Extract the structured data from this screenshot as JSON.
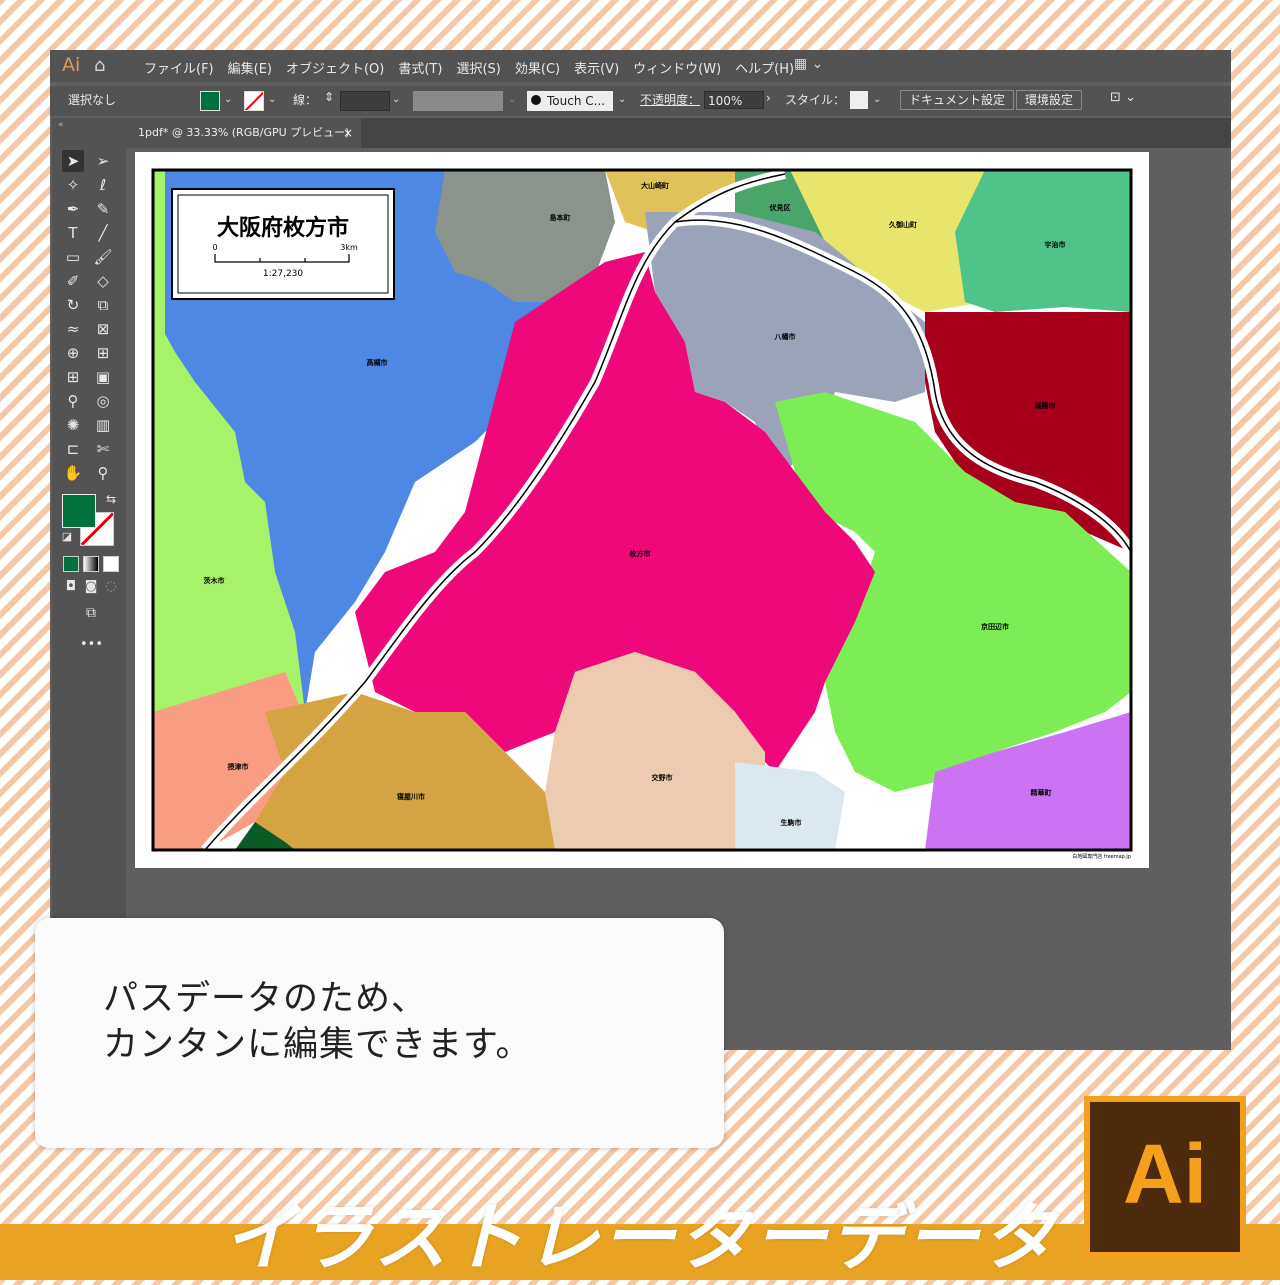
{
  "app": {
    "logo": "Ai",
    "menus": [
      "ファイル(F)",
      "編集(E)",
      "オブジェクト(O)",
      "書式(T)",
      "選択(S)",
      "効果(C)",
      "表示(V)",
      "ウィンドウ(W)",
      "ヘルプ(H)"
    ]
  },
  "control": {
    "selection": "選択なし",
    "stroke_label": "線：",
    "brush": "Touch C...",
    "opacity_label": "不透明度：",
    "opacity_value": "100%",
    "style_label": "スタイル：",
    "doc_setup": "ドキュメント設定",
    "prefs": "環境設定",
    "fill_color": "#00703c"
  },
  "tab": {
    "title": "1pdf* @ 33.33% (RGB/GPU プレビュー)",
    "close": "×"
  },
  "map": {
    "title": "大阪府枚方市",
    "scale_zero": "0",
    "scale_max": "3km",
    "scale_ratio": "1:27,230",
    "credit": "白地図専門店 freemap.jp",
    "places": [
      "大山崎町",
      "島本町",
      "伏見区",
      "久御山町",
      "宇治市",
      "高槻市",
      "八幡市",
      "城陽市",
      "枚方市",
      "京田辺市",
      "茨木市",
      "摂津市",
      "寝屋川市",
      "交野市",
      "生駒市",
      "精華町"
    ]
  },
  "caption": {
    "line1": "パスデータのため、",
    "line2": "カンタンに編集できます。"
  },
  "banner": {
    "title": "イラストレーターデータ",
    "logo": "Ai"
  }
}
